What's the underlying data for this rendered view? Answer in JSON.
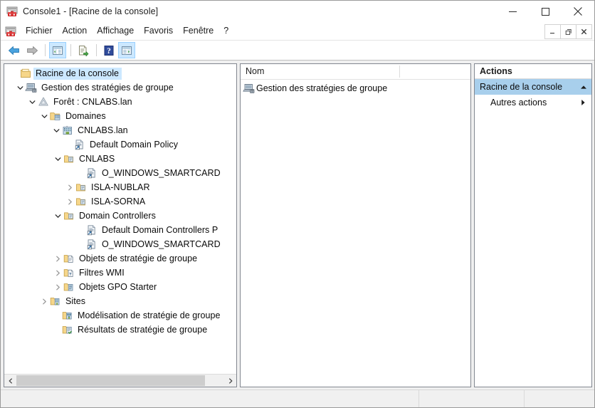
{
  "window": {
    "title": "Console1 - [Racine de la console]",
    "app_icon": "mmc-console-icon",
    "controls": {
      "minimize": "minimize-icon",
      "maximize": "maximize-icon",
      "close": "close-icon"
    },
    "mdi_controls": {
      "minimize": "mdi-minimize-icon",
      "restore": "mdi-restore-icon",
      "close": "mdi-close-icon"
    }
  },
  "menubar": {
    "icon": "mmc-console-icon",
    "items": [
      {
        "label": "Fichier"
      },
      {
        "label": "Action"
      },
      {
        "label": "Affichage"
      },
      {
        "label": "Favoris"
      },
      {
        "label": "Fenêtre"
      },
      {
        "label": "?"
      }
    ]
  },
  "toolbar": {
    "buttons": [
      {
        "name": "back-button",
        "icon": "arrow-left-icon",
        "pressed": false
      },
      {
        "name": "forward-button",
        "icon": "arrow-right-icon",
        "pressed": false
      },
      {
        "name": "show-hide-tree-button",
        "icon": "console-tree-icon",
        "pressed": true
      },
      {
        "name": "export-list-button",
        "icon": "export-list-icon",
        "pressed": false
      },
      {
        "name": "help-button",
        "icon": "help-question-icon",
        "pressed": false
      },
      {
        "name": "show-action-pane-button",
        "icon": "action-pane-icon",
        "pressed": true
      }
    ]
  },
  "tree": {
    "nodes": [
      {
        "label": "Racine de la console",
        "depth": 0,
        "icon": "console-root-folder-icon",
        "expander": "none",
        "selected": true
      },
      {
        "label": "Gestion des stratégies de groupe",
        "depth": 1,
        "icon": "gpmc-snapin-icon",
        "expander": "expanded",
        "selected": false
      },
      {
        "label": "Forêt : CNLABS.lan",
        "depth": 2,
        "icon": "forest-icon",
        "expander": "expanded",
        "selected": false
      },
      {
        "label": "Domaines",
        "depth": 3,
        "icon": "domains-folder-icon",
        "expander": "expanded",
        "selected": false
      },
      {
        "label": "CNLABS.lan",
        "depth": 4,
        "icon": "domain-icon",
        "expander": "expanded",
        "selected": false
      },
      {
        "label": "Default Domain Policy",
        "depth": 5,
        "icon": "gpo-link-icon",
        "expander": "none",
        "selected": false
      },
      {
        "label": "CNLABS",
        "depth": 5,
        "icon": "ou-folder-icon",
        "expander": "expanded",
        "selected": false
      },
      {
        "label": "O_WINDOWS_SMARTCARD",
        "depth": 6,
        "icon": "gpo-link-icon",
        "expander": "none",
        "selected": false
      },
      {
        "label": "ISLA-NUBLAR",
        "depth": 6,
        "icon": "ou-folder-icon",
        "expander": "collapsed",
        "selected": false
      },
      {
        "label": "ISLA-SORNA",
        "depth": 6,
        "icon": "ou-folder-icon",
        "expander": "collapsed",
        "selected": false
      },
      {
        "label": "Domain Controllers",
        "depth": 5,
        "icon": "ou-folder-icon",
        "expander": "expanded",
        "selected": false
      },
      {
        "label": "Default Domain Controllers P",
        "depth": 6,
        "icon": "gpo-link-icon",
        "expander": "none",
        "selected": false
      },
      {
        "label": "O_WINDOWS_SMARTCARD",
        "depth": 6,
        "icon": "gpo-link-icon",
        "expander": "none",
        "selected": false
      },
      {
        "label": "Objets de stratégie de groupe",
        "depth": 5,
        "icon": "gpo-objects-folder-icon",
        "expander": "collapsed",
        "selected": false
      },
      {
        "label": "Filtres WMI",
        "depth": 5,
        "icon": "wmi-filters-folder-icon",
        "expander": "collapsed",
        "selected": false
      },
      {
        "label": "Objets GPO Starter",
        "depth": 5,
        "icon": "starter-gpo-folder-icon",
        "expander": "collapsed",
        "selected": false
      },
      {
        "label": "Sites",
        "depth": 3,
        "icon": "sites-folder-icon",
        "expander": "collapsed",
        "selected": false
      },
      {
        "label": "Modélisation de stratégie de groupe",
        "depth": 4,
        "icon": "gp-modeling-icon",
        "expander": "none",
        "selected": false
      },
      {
        "label": "Résultats de stratégie de groupe",
        "depth": 4,
        "icon": "gp-results-icon",
        "expander": "none",
        "selected": false
      }
    ],
    "scrollbar": {
      "left_arrow": "scroll-left-icon",
      "right_arrow": "scroll-right-icon"
    }
  },
  "list": {
    "columns": [
      {
        "label": "Nom"
      },
      {
        "label": ""
      }
    ],
    "rows": [
      {
        "name": "Gestion des stratégies de groupe",
        "icon": "gpmc-snapin-icon"
      }
    ]
  },
  "actions": {
    "header": "Actions",
    "group": {
      "label": "Racine de la console",
      "chevron": "chevron-up-icon"
    },
    "items": [
      {
        "label": "Autres actions",
        "chevron": "chevron-right-icon"
      }
    ]
  },
  "statusbar": {
    "segments": [
      "",
      "",
      ""
    ]
  },
  "colors": {
    "selection": "#cce8ff",
    "action_group": "#a8cfec",
    "folder": "#f6d68a",
    "window_bg": "#f0f0f0",
    "pane_border": "#828790"
  }
}
